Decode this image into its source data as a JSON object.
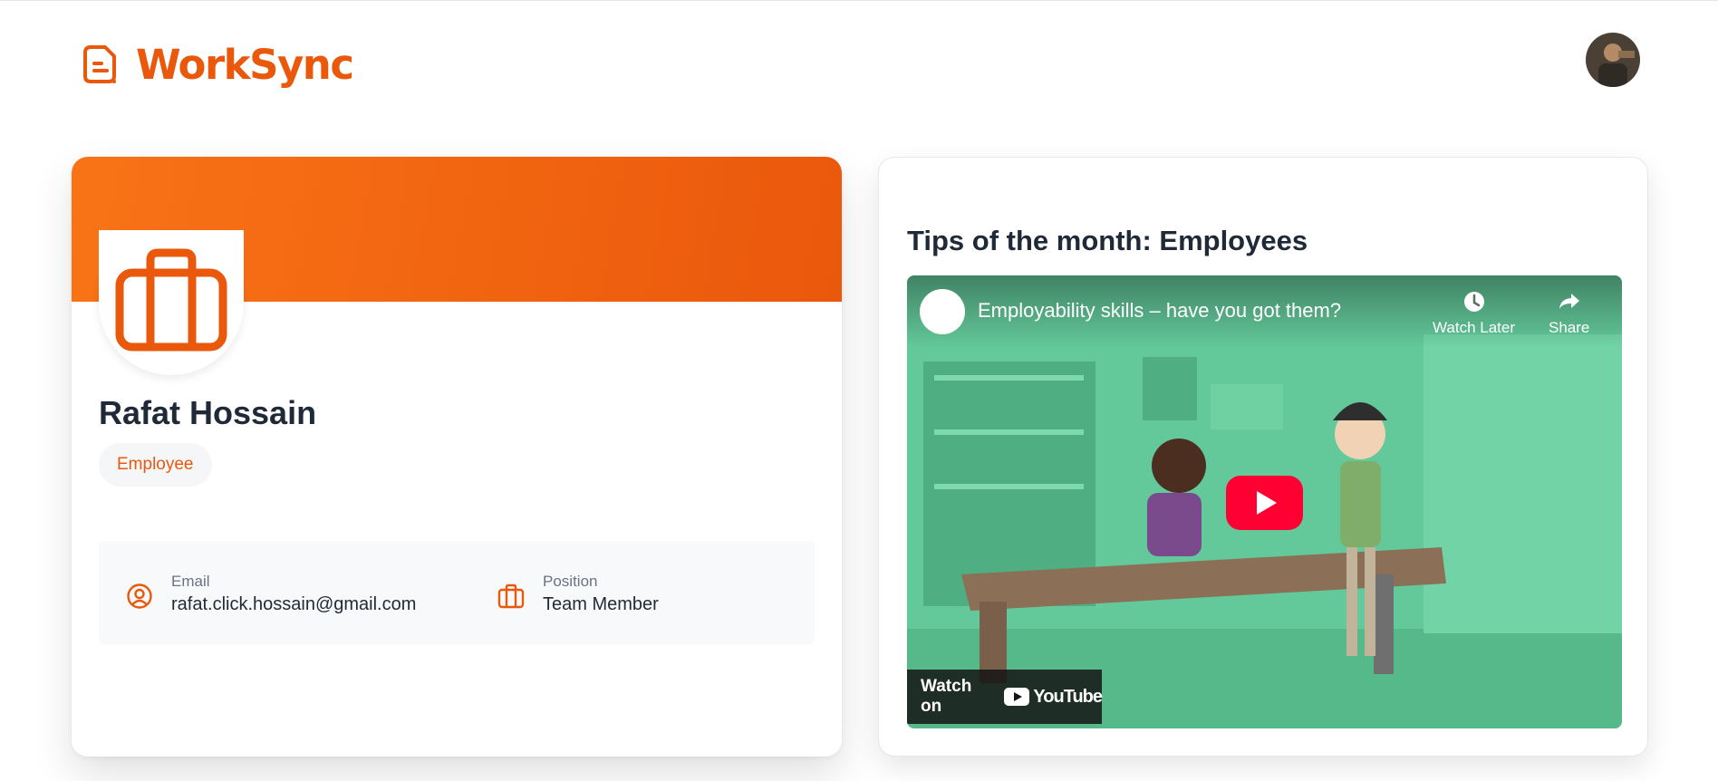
{
  "app": {
    "name": "WorkSync"
  },
  "profile": {
    "name": "Rafat Hossain",
    "role": "Employee",
    "email_label": "Email",
    "email": "rafat.click.hossain@gmail.com",
    "position_label": "Position",
    "position": "Team Member"
  },
  "tips": {
    "title": "Tips of the month: Employees",
    "video": {
      "title": "Employability skills – have you got them?",
      "watch_later": "Watch Later",
      "share": "Share",
      "watch_on": "Watch on",
      "youtube": "YouTube"
    }
  },
  "colors": {
    "accent": "#ea580c",
    "accent_light": "#f97316",
    "video_bg": "#5ec695"
  },
  "icons": [
    "logo-icon",
    "user-avatar",
    "briefcase-icon",
    "user-circle-icon",
    "clock-icon",
    "share-icon",
    "play-icon",
    "youtube-icon"
  ]
}
